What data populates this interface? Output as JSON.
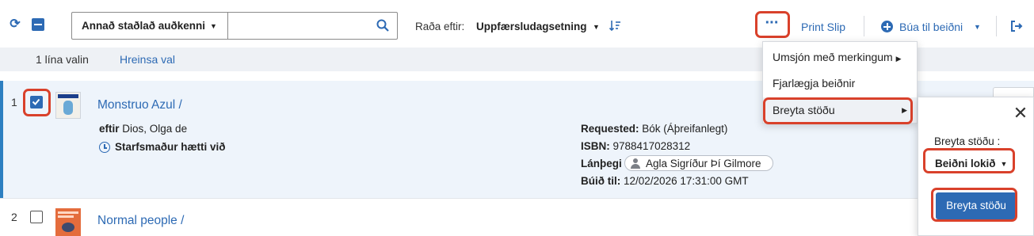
{
  "toolbar": {
    "search_type": "Annað staðlað auðkenni",
    "search_value": "",
    "search_placeholder": "",
    "sort_label": "Raða eftir:",
    "sort_value": "Uppfærsludagsetning",
    "more_label": "···",
    "print_slip": "Print Slip",
    "create_request": "Búa til beiðni"
  },
  "selection": {
    "count_text": "1 lína valin",
    "clear_text": "Hreinsa val"
  },
  "rows": [
    {
      "num": "1",
      "title": "Monstruo Azul /",
      "author_prefix": "eftir",
      "author": "Dios, Olga de",
      "status": "Starfsmaður hætti við",
      "requested_label": "Requested:",
      "requested_value": "Bók (Áþreifanlegt)",
      "isbn_label": "ISBN:",
      "isbn_value": "9788417028312",
      "borrower_label": "Lánþegi",
      "borrower_value": "Agla Sigríður Þí Gilmore",
      "created_label": "Búið til:",
      "created_value": "12/02/2026 17:31:00 GMT",
      "checked": true
    },
    {
      "num": "2",
      "title": "Normal people /",
      "checked": false
    }
  ],
  "menu": {
    "items": [
      {
        "label": "Umsjón með merkingum"
      },
      {
        "label": "Fjarlægja beiðnir"
      },
      {
        "label": "Breyta stöðu"
      }
    ]
  },
  "status_panel": {
    "label": "Breyta stöðu :",
    "selected_value": "Beiðni lokið",
    "button_label": "Breyta stöðu"
  },
  "colors": {
    "accent": "#2d6ab4",
    "highlight": "#d9412b",
    "row_selected_bg": "#eef4fb"
  }
}
